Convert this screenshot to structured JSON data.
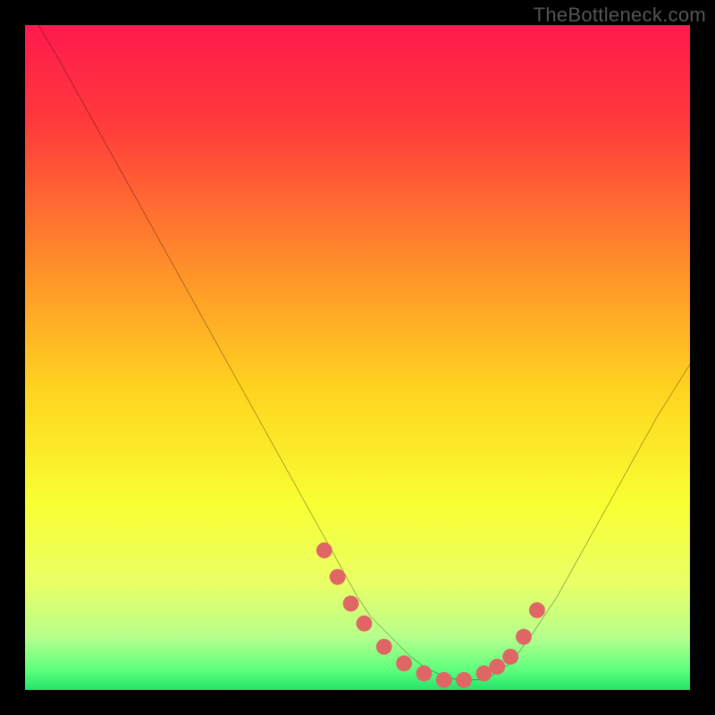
{
  "watermark": "TheBottleneck.com",
  "chart_data": {
    "type": "line",
    "title": "",
    "xlabel": "",
    "ylabel": "",
    "xlim": [
      0,
      100
    ],
    "ylim": [
      0,
      100
    ],
    "grid": false,
    "series": [
      {
        "name": "curve",
        "color": "#000000",
        "x": [
          2,
          5,
          10,
          15,
          20,
          25,
          30,
          35,
          40,
          45,
          50,
          52,
          55,
          58,
          60,
          62,
          65,
          68,
          70,
          73,
          76,
          80,
          85,
          90,
          95,
          100
        ],
        "y": [
          100,
          95,
          86,
          77,
          68,
          59,
          50,
          41,
          32,
          23,
          14,
          11,
          8,
          5,
          3.5,
          2.5,
          1.5,
          1.5,
          2,
          4,
          8,
          14,
          23,
          32,
          41,
          49
        ]
      }
    ],
    "markers": {
      "name": "dots",
      "color": "#e06666",
      "radius": 1.2,
      "x": [
        45,
        47,
        49,
        51,
        54,
        57,
        60,
        63,
        66,
        69,
        71,
        73,
        75,
        77
      ],
      "y": [
        21,
        17,
        13,
        10,
        6.5,
        4,
        2.5,
        1.5,
        1.5,
        2.5,
        3.5,
        5,
        8,
        12
      ]
    },
    "background": {
      "type": "vertical-gradient",
      "stops": [
        {
          "offset": 0.0,
          "color": "#ff1a4d"
        },
        {
          "offset": 0.15,
          "color": "#ff3b3b"
        },
        {
          "offset": 0.35,
          "color": "#ff8a2b"
        },
        {
          "offset": 0.55,
          "color": "#ffd51f"
        },
        {
          "offset": 0.72,
          "color": "#f8ff33"
        },
        {
          "offset": 0.84,
          "color": "#e9ff66"
        },
        {
          "offset": 0.92,
          "color": "#b6ff8c"
        },
        {
          "offset": 0.97,
          "color": "#5eff7d"
        },
        {
          "offset": 1.0,
          "color": "#24e36b"
        }
      ]
    }
  }
}
